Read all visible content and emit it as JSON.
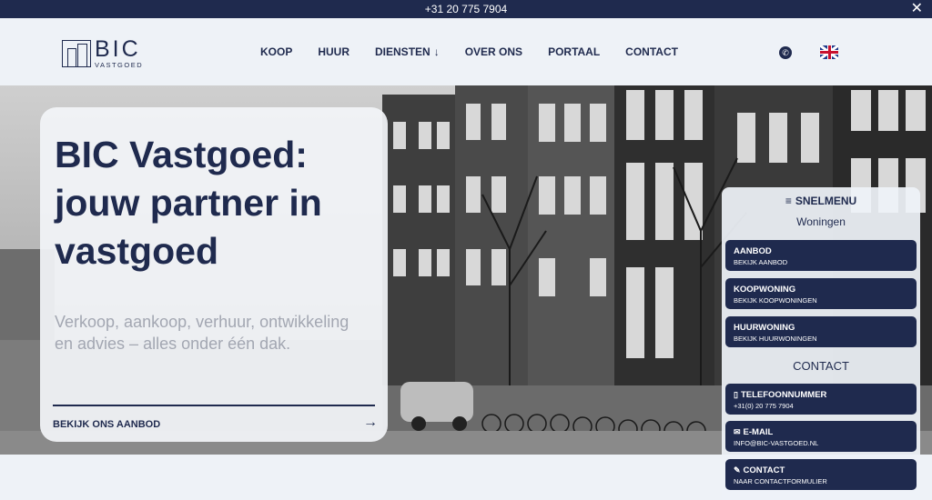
{
  "topbar": {
    "phone": "+31 20 775 7904",
    "close_icon": "close-icon"
  },
  "logo": {
    "name": "BIC",
    "tagline": "VASTGOED"
  },
  "nav": {
    "items": [
      {
        "label": "KOOP"
      },
      {
        "label": "HUUR"
      },
      {
        "label": "DIENSTEN",
        "has_dropdown": true
      },
      {
        "label": "OVER ONS"
      },
      {
        "label": "PORTAAL"
      },
      {
        "label": "CONTACT"
      }
    ]
  },
  "header_icons": {
    "phone": "phone-icon",
    "language": "uk-flag-icon"
  },
  "hero": {
    "title": "BIC Vastgoed: jouw partner in vastgoed",
    "subtitle": "Verkoop, aankoop, verhuur, ontwikkeling en advies – alles onder één dak.",
    "cta_label": "BEKIJK ONS AANBOD",
    "cta_icon": "arrow-right-icon"
  },
  "quickmenu": {
    "title": "SNELMENU",
    "subtitle": "Woningen",
    "contact_heading": "CONTACT",
    "items": [
      {
        "title": "AANBOD",
        "sub": "BEKIJK AANBOD"
      },
      {
        "title": "KOOPWONING",
        "sub": "BEKIJK KOOPWONINGEN"
      },
      {
        "title": "HUURWONING",
        "sub": "BEKIJK HUURWONINGEN"
      }
    ],
    "contact_items": [
      {
        "title": "TELEFOONNUMMER",
        "sub": "+31(0) 20 775 7904",
        "icon": "phone-icon"
      },
      {
        "title": "E-MAIL",
        "sub": "INFO@BIC-VASTGOED.NL",
        "icon": "envelope-icon"
      },
      {
        "title": "CONTACT",
        "sub": "NAAR CONTACTFORMULIER",
        "icon": "form-icon"
      }
    ]
  },
  "colors": {
    "primary": "#1f2a4e",
    "background": "#eef2f7",
    "subtitle": "#a3a7b2"
  }
}
